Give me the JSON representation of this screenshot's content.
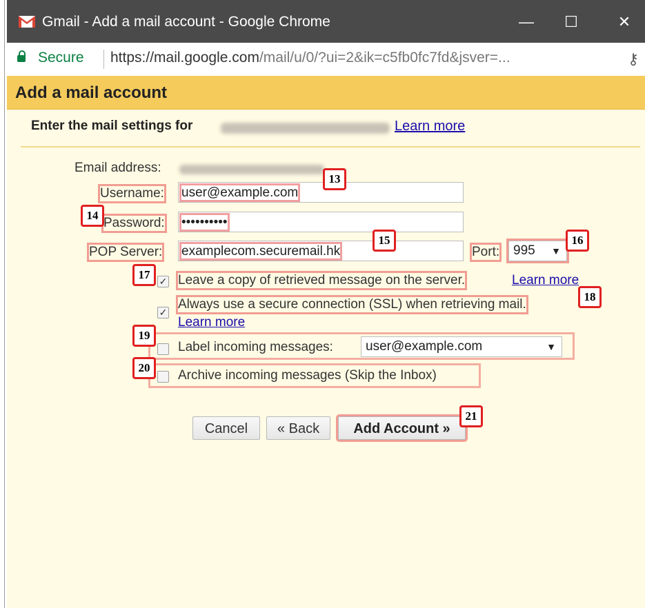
{
  "window": {
    "title": "Gmail - Add a mail account - Google Chrome",
    "minimize_glyph": "—",
    "maximize_glyph": "☐",
    "close_glyph": "✕"
  },
  "addressbar": {
    "secure_label": "Secure",
    "url_host": "https://mail.google.com",
    "url_path": "/mail/u/0/?ui=2&ik=c5fb0fc7fd&jsver=...",
    "key_icon": "key-icon"
  },
  "dialog": {
    "title": "Add a mail account",
    "subheading": "Enter the mail settings for",
    "learn_more": "Learn more",
    "fields": {
      "email_label": "Email address:",
      "username_label": "Username:",
      "username_value": "user@example.com",
      "password_label": "Password:",
      "password_value": "••••••••••",
      "pop_server_label": "POP Server:",
      "pop_server_value": "examplecom.securemail.hk",
      "port_label": "Port:",
      "port_value": "995"
    },
    "options": {
      "leave_copy": "Leave a copy of retrieved message on the server.",
      "leave_copy_learn": "Learn more",
      "leave_copy_checked": true,
      "ssl": "Always use a secure connection (SSL) when retrieving mail.",
      "ssl_learn": "Learn more",
      "ssl_checked": true,
      "label_incoming": "Label incoming messages:",
      "label_value": "user@example.com",
      "label_checked": false,
      "archive": "Archive incoming messages (Skip the Inbox)",
      "archive_checked": false
    },
    "buttons": {
      "cancel": "Cancel",
      "back": "« Back",
      "add_account": "Add Account »"
    },
    "badges": [
      "13",
      "14",
      "15",
      "16",
      "17",
      "18",
      "19",
      "20",
      "21"
    ]
  },
  "colors": {
    "titlebar": "#4a4a4a",
    "dialog_header": "#f5cb5c",
    "dialog_bg": "#fffbe4",
    "secure_green": "#0b8043",
    "link": "#1a0dab",
    "badge_border": "#e02020"
  }
}
